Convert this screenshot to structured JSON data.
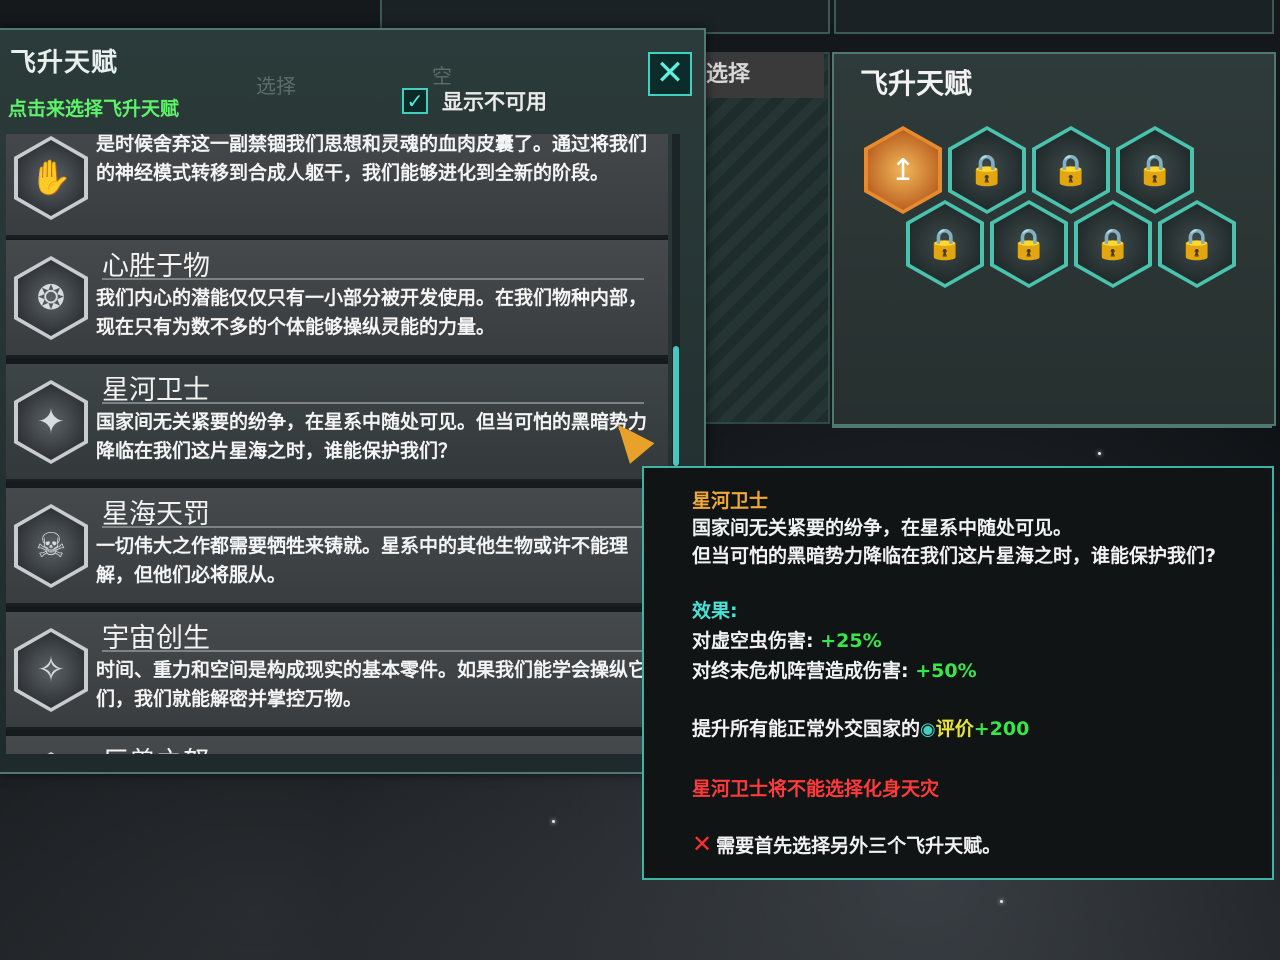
{
  "left_panel": {
    "title": "飞升天赋",
    "subtitle": "点击来选择飞升天赋",
    "ghost_select": "选择",
    "ghost_empty": "空",
    "checkbox_label": "显示不可用",
    "checkbox_mark": "✓",
    "close_glyph": "✕"
  },
  "perks": [
    {
      "title": "",
      "icon": "✋",
      "icon_name": "cyber-hand-icon",
      "desc": "是时候舍弃这一副禁锢我们思想和灵魂的血肉皮囊了。通过将我们的神经模式转移到合成人躯干，我们能够进化到全新的阶段。"
    },
    {
      "title": "心胜于物",
      "icon": "❂",
      "icon_name": "brain-icon",
      "desc": "我们内心的潜能仅仅只有一小部分被开发使用。在我们物种内部，现在只有为数不多的个体能够操纵灵能的力量。"
    },
    {
      "title": "星河卫士",
      "icon": "✦",
      "icon_name": "shattered-shield-icon",
      "desc": "国家间无关紧要的纷争，在星系中随处可见。但当可怕的黑暗势力降临在我们这片星海之时，谁能保护我们？"
    },
    {
      "title": "星海天罚",
      "icon": "☠",
      "icon_name": "skull-icon",
      "desc": "一切伟大之作都需要牺牲来铸就。星系中的其他生物或许不能理解，但他们必将服从。"
    },
    {
      "title": "宇宙创生",
      "icon": "✧",
      "icon_name": "cosmic-compass-icon",
      "desc": "时间、重力和空间是构成现实的基本零件。如果我们能学会操纵它们，我们就能解密并掌控万物。"
    },
    {
      "title": "巨兽之怒",
      "icon": "▲",
      "icon_name": "beast-icon",
      "desc": ""
    }
  ],
  "middle": {
    "tab_label": "选择"
  },
  "right_panel": {
    "title": "飞升天赋",
    "slot_icon": "🔒",
    "selected_icon": "↥"
  },
  "tooltip": {
    "title": "星河卫士",
    "desc1": "国家间无关紧要的纷争，在星系中随处可见。",
    "desc2": "但当可怕的黑暗势力降临在我们这片星海之时，谁能保护我们?",
    "effect_label": "效果:",
    "mod1_label": "对虚空虫伤害:",
    "mod1_value": "+25%",
    "mod2_label": "对终末危机阵营造成伤害:",
    "mod2_value": "+50%",
    "opinion_prefix": "提升所有能正常外交国家的",
    "opinion_label": "评价",
    "opinion_value": "+200",
    "exclusive": "星河卫士将不能选择化身天灾",
    "requirement_glyph": "✕",
    "requirement": "需要首先选择另外三个飞升天赋。"
  },
  "colors": {
    "accent": "#3fb3a6",
    "green": "#39e64a",
    "orange": "#f0a83a",
    "red": "#ff3a3a"
  }
}
